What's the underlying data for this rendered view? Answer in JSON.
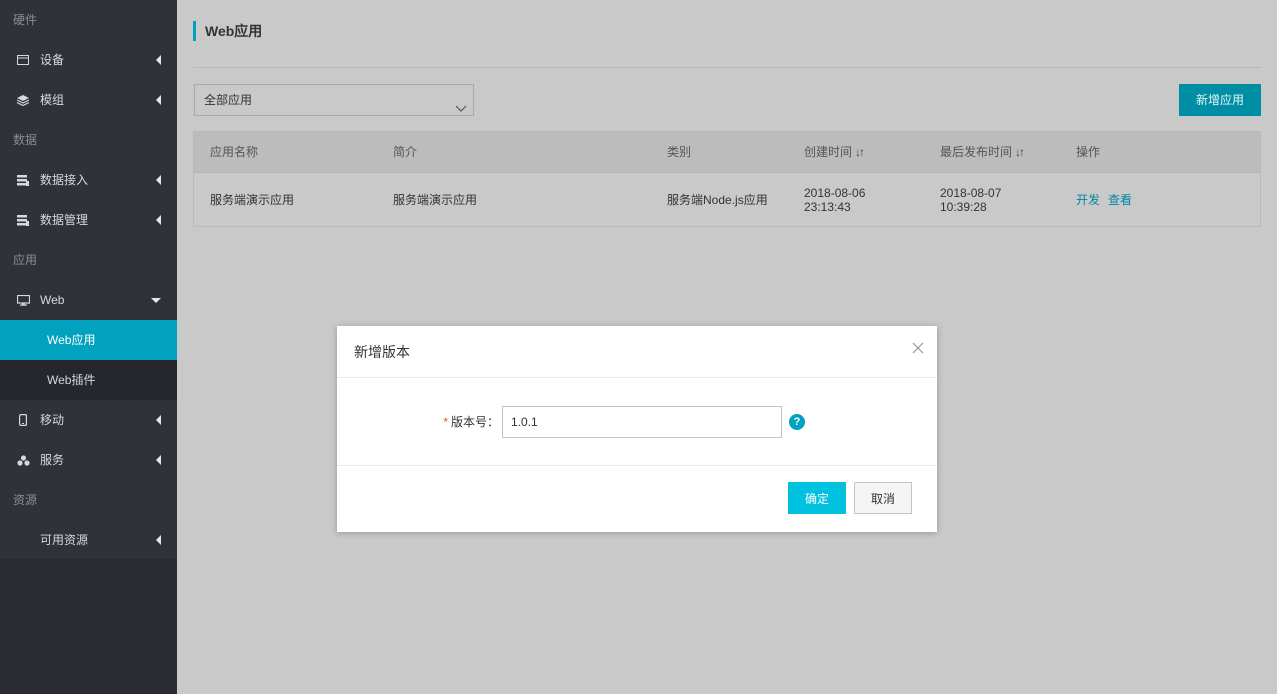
{
  "colors": {
    "accent": "#00a2bf",
    "sidebar_bg": "#30323a",
    "primary_button": "#00c1de",
    "required_star": "#e5533c",
    "link": "#0086a8"
  },
  "sidebar": {
    "sections": {
      "hardware": "硬件",
      "data": "数据",
      "apps": "应用",
      "resources": "资源"
    },
    "items": {
      "device": {
        "label": "设备",
        "icon": "device-icon"
      },
      "module": {
        "label": "模组",
        "icon": "layers-icon"
      },
      "data_access": {
        "label": "数据接入",
        "icon": "database-icon"
      },
      "data_manage": {
        "label": "数据管理",
        "icon": "database-icon"
      },
      "web": {
        "label": "Web",
        "icon": "monitor-icon",
        "expanded": true
      },
      "web_apps": {
        "label": "Web应用",
        "active": true
      },
      "web_plugins": {
        "label": "Web插件"
      },
      "mobile": {
        "label": "移动",
        "icon": "mobile-icon"
      },
      "service": {
        "label": "服务",
        "icon": "cluster-icon"
      },
      "available_resources": {
        "label": "可用资源"
      }
    }
  },
  "main": {
    "title": "Web应用",
    "filter_select": {
      "value": "全部应用"
    },
    "new_app_button": "新增应用",
    "table": {
      "columns": {
        "name": "应用名称",
        "intro": "简介",
        "category": "类别",
        "created": "创建时间",
        "published": "最后发布时间",
        "actions": "操作"
      },
      "rows": [
        {
          "name": "服务端演示应用",
          "intro": "服务端演示应用",
          "category": "服务端Node.js应用",
          "created": "2018-08-06 23:13:43",
          "published": "2018-08-07 10:39:28",
          "action_develop": "开发",
          "action_view": "查看"
        }
      ]
    }
  },
  "modal": {
    "title": "新增版本",
    "field_label": "版本号：",
    "field_value": "1.0.1",
    "help_glyph": "?",
    "ok_button": "确定",
    "cancel_button": "取消"
  }
}
